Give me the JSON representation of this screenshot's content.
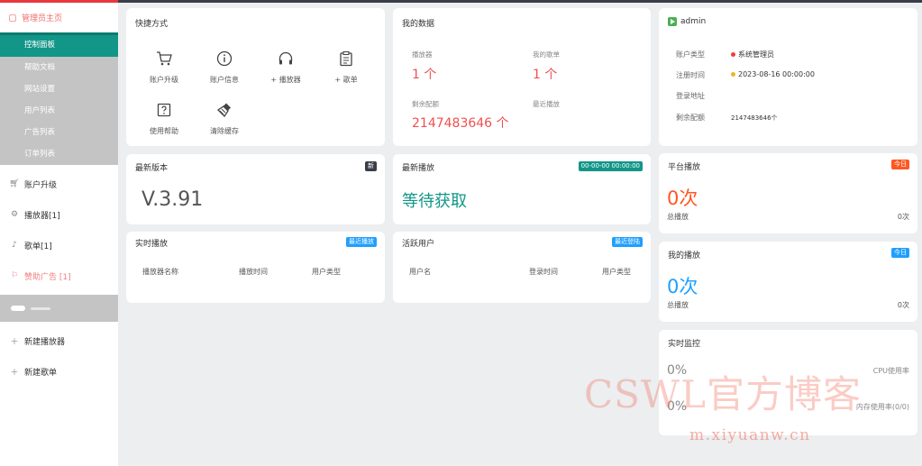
{
  "sidebar": {
    "title": "管理员主页",
    "sub_items": [
      "控制面板",
      "帮助文档",
      "网站设置",
      "用户列表",
      "广告列表",
      "订单列表"
    ],
    "items": [
      {
        "label": "账户升级",
        "icon": "cart-icon"
      },
      {
        "label": "播放器[1]",
        "icon": "gear-icon"
      },
      {
        "label": "歌单[1]",
        "icon": "music-icon"
      },
      {
        "label": "赞助广告 [1]",
        "icon": "flag-icon"
      }
    ],
    "bottom_items": [
      {
        "label": "新建播放器",
        "icon": "plus-icon"
      },
      {
        "label": "新建歌单",
        "icon": "plus-icon"
      }
    ]
  },
  "shortcuts": {
    "title": "快捷方式",
    "items": [
      {
        "label": "账户升级",
        "icon": "cart-icon"
      },
      {
        "label": "账户信息",
        "icon": "info-icon"
      },
      {
        "label": "+ 播放器",
        "icon": "headphones-icon"
      },
      {
        "label": "+ 歌单",
        "icon": "clipboard-icon"
      },
      {
        "label": "使用帮助",
        "icon": "help-icon"
      },
      {
        "label": "清除缓存",
        "icon": "broom-icon"
      }
    ]
  },
  "mydata": {
    "title": "我的数据",
    "players_label": "播放器",
    "players_value": "1 个",
    "playlists_label": "我的歌单",
    "playlists_value": "1 个",
    "quota_label": "剩余配额",
    "quota_value": "2147483646 个",
    "recent_label": "最近播放"
  },
  "account": {
    "username": "admin",
    "type_label": "账户类型",
    "type_value": "系统管理员",
    "reg_label": "注册时间",
    "reg_value": "2023-08-16 00:00:00",
    "login_label": "登录地址",
    "login_value": "",
    "quota_label": "剩余配额",
    "quota_value": "2147483646个"
  },
  "latest_version": {
    "title": "最新版本",
    "badge": "新",
    "value": "V.3.91"
  },
  "latest_play": {
    "title": "最新播放",
    "badge": "00-00-00 00:00:00",
    "value": "等待获取"
  },
  "platform_play": {
    "title": "平台播放",
    "badge": "今日",
    "value": "0次",
    "total_label": "总播放",
    "total_value": "0次"
  },
  "my_play": {
    "title": "我的播放",
    "badge": "今日",
    "value": "0次",
    "total_label": "总播放",
    "total_value": "0次"
  },
  "realtime_play": {
    "title": "实时播放",
    "badge": "最近播放",
    "columns": [
      "播放器名称",
      "播放时间",
      "用户类型"
    ]
  },
  "active_users": {
    "title": "活跃用户",
    "badge": "最近登陆",
    "columns": [
      "用户名",
      "登录时间",
      "用户类型"
    ]
  },
  "monitor": {
    "title": "实时监控",
    "cpu_value": "0%",
    "cpu_label": "CPU使用率",
    "mem_value": "0%",
    "mem_label": "内存使用率(0/0)"
  },
  "watermark": {
    "text": "CSWL官方博客",
    "url": "m.xiyuanw.cn"
  },
  "colors": {
    "accent": "#129688",
    "red": "#f05050",
    "orange": "#ff5722",
    "blue": "#1e9fff",
    "dark": "#393d49"
  }
}
